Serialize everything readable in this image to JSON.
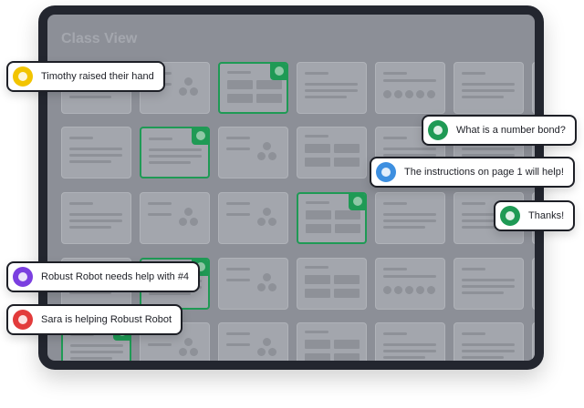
{
  "class_view": {
    "title": "Class View"
  },
  "notifications": [
    {
      "text": "Timothy raised their hand",
      "avatar_color": "#f2c400",
      "icon": "raised-hand-icon"
    },
    {
      "text": "What is a number bond?",
      "avatar_color": "#1f9a55",
      "icon": "student-avatar-icon"
    },
    {
      "text": "The instructions on page 1 will help!",
      "avatar_color": "#3d8fe0",
      "icon": "teacher-avatar-icon"
    },
    {
      "text": "Thanks!",
      "avatar_color": "#1f9a55",
      "icon": "student-avatar-icon"
    },
    {
      "text": "Robust Robot needs help with #4",
      "avatar_color": "#7b3fe0",
      "icon": "robot-avatar-icon"
    },
    {
      "text": "Sara is helping Robust Robot",
      "avatar_color": "#e23b3b",
      "icon": "student-avatar-icon"
    }
  ],
  "colors": {
    "accent_green": "#1f9a55",
    "frame": "#23262f",
    "overlay": "#8c8f97"
  }
}
